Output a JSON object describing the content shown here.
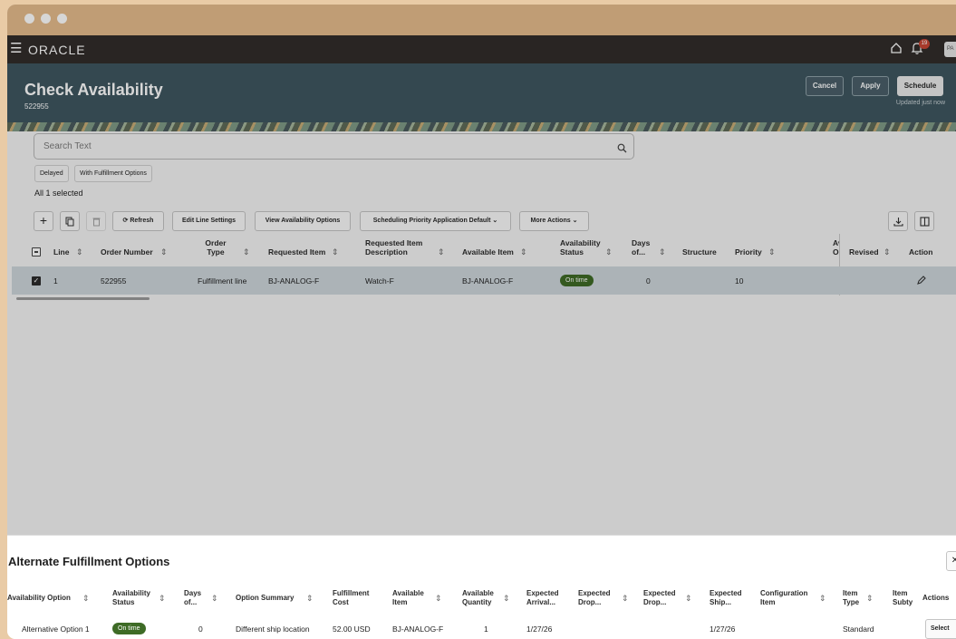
{
  "topbar": {
    "brand": "ORACLE",
    "notification_count": "19",
    "user_initials": "PA"
  },
  "header": {
    "title": "Check Availability",
    "order_id": "522955",
    "cancel_label": "Cancel",
    "apply_label": "Apply",
    "schedule_label": "Schedule",
    "updated_text": "Updated just now"
  },
  "search": {
    "placeholder": "Search Text"
  },
  "filters": [
    "Delayed",
    "With Fulfillment Options"
  ],
  "selection_text": "All 1 selected",
  "toolbar": {
    "refresh_label": "Refresh",
    "edit_line_settings_label": "Edit Line Settings",
    "view_options_label": "View Availability Options",
    "scheduling_priority_label": "Scheduling Priority Application Default",
    "more_actions_label": "More Actions"
  },
  "table": {
    "columns": {
      "line": "Line",
      "order_number": "Order Number",
      "order_type": "Order Type",
      "requested_item": "Requested Item",
      "requested_item_description": "Requested Item Description",
      "available_item": "Available Item",
      "availability_status": "Availability Status",
      "days_of": "Days of...",
      "structure": "Structure",
      "priority": "Priority",
      "cut_col": "Av Op",
      "revised": "Revised",
      "action": "Action"
    },
    "rows": [
      {
        "line": "1",
        "order_number": "522955",
        "order_type": "Fulfillment line",
        "requested_item": "BJ-ANALOG-F",
        "requested_item_description": "Watch-F",
        "available_item": "BJ-ANALOG-F",
        "availability_status": "On time",
        "days_of": "0",
        "priority": "10"
      }
    ]
  },
  "drawer": {
    "title": "Alternate Fulfillment Options",
    "columns": {
      "availability_option": "Availability Option",
      "availability_status": "Availability Status",
      "days_of": "Days of...",
      "option_summary": "Option Summary",
      "fulfillment_cost": "Fulfillment Cost",
      "available_item": "Available Item",
      "available_quantity": "Available Quantity",
      "expected_arrival": "Expected Arrival...",
      "expected_drop_1": "Expected Drop...",
      "expected_drop_2": "Expected Drop...",
      "expected_ship": "Expected Ship...",
      "configuration_item": "Configuration Item",
      "item_type": "Item Type",
      "item_subtype": "Item Subty",
      "actions": "Actions"
    },
    "rows": [
      {
        "availability_option": "Alternative Option 1",
        "availability_status": "On time",
        "days_of": "0",
        "option_summary": "Different ship location",
        "fulfillment_cost": "52.00 USD",
        "available_item": "BJ-ANALOG-F",
        "available_quantity": "1",
        "expected_arrival": "1/27/26",
        "expected_ship": "1/27/26",
        "item_type": "Standard",
        "select_label": "Select"
      }
    ]
  },
  "colors": {
    "titlebar": "#e5bc8c",
    "topbar": "#312d2a",
    "header": "#3f5660",
    "badge_green": "#3e6b26",
    "selected_row": "#cdd6db"
  }
}
